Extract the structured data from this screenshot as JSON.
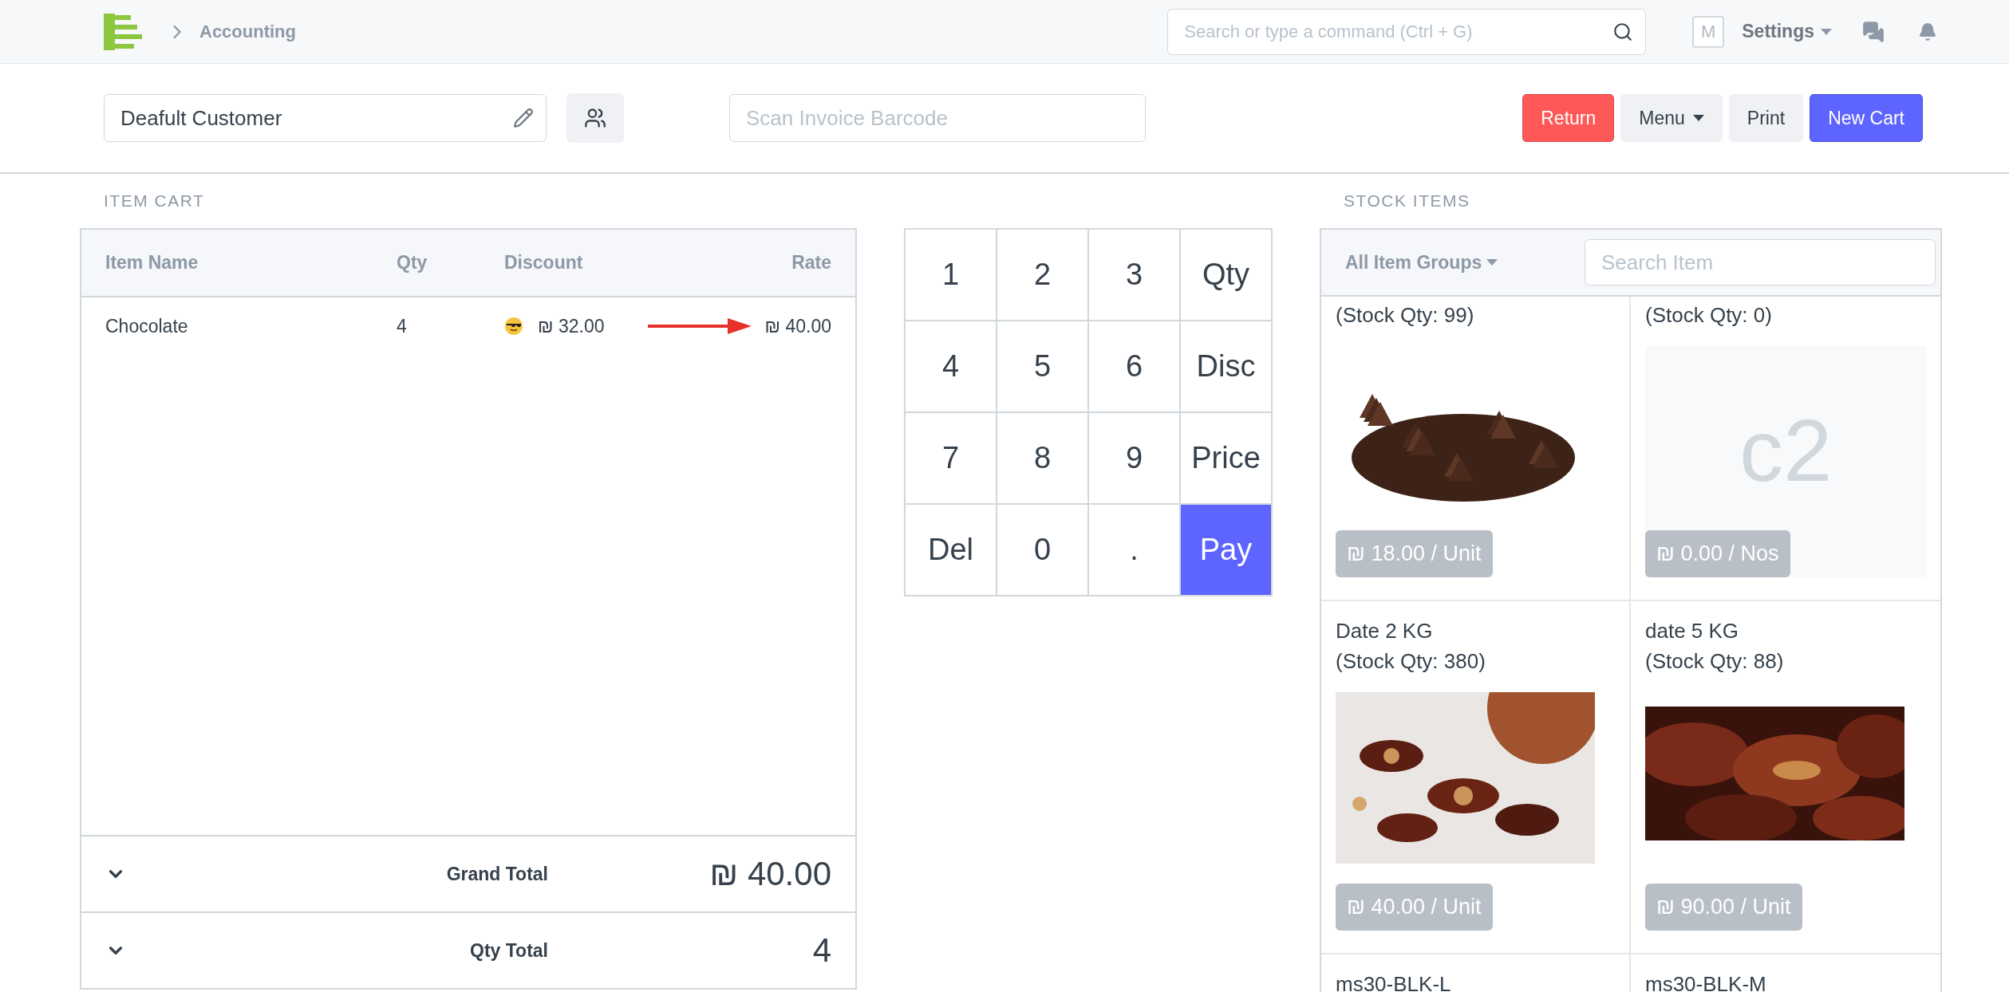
{
  "navbar": {
    "breadcrumb": "Accounting",
    "search": {
      "placeholder": "Search or type a command (Ctrl + G)"
    },
    "avatar": "M",
    "settings": "Settings"
  },
  "toolbar": {
    "customer": "Deafult Customer",
    "barcode": {
      "placeholder": "Scan Invoice Barcode"
    },
    "buttons": [
      {
        "label": "Return",
        "kind": "danger"
      },
      {
        "label": "Menu",
        "kind": "dropdown"
      },
      {
        "label": "Print",
        "kind": "default"
      },
      {
        "label": "New Cart",
        "kind": "primary"
      }
    ]
  },
  "cart": {
    "title": "ITEM CART",
    "columns": [
      "Item Name",
      "Qty",
      "Discount",
      "Rate"
    ],
    "rows": [
      {
        "item_name": "Chocolate",
        "qty": "4",
        "discount": "₪ 32.00",
        "rate": "₪ 40.00",
        "marked": true
      }
    ],
    "totals": [
      {
        "label": "Grand Total",
        "value": "₪ 40.00"
      },
      {
        "label": "Qty Total",
        "value": "4"
      }
    ]
  },
  "numpad": [
    {
      "label": "1",
      "selected": false
    },
    {
      "label": "2",
      "selected": false
    },
    {
      "label": "3",
      "selected": false
    },
    {
      "label": "Qty",
      "selected": false
    },
    {
      "label": "4",
      "selected": false
    },
    {
      "label": "5",
      "selected": false
    },
    {
      "label": "6",
      "selected": false
    },
    {
      "label": "Disc",
      "selected": false
    },
    {
      "label": "7",
      "selected": false
    },
    {
      "label": "8",
      "selected": false
    },
    {
      "label": "9",
      "selected": false
    },
    {
      "label": "Price",
      "selected": false
    },
    {
      "label": "Del",
      "selected": false
    },
    {
      "label": "0",
      "selected": false
    },
    {
      "label": ".",
      "selected": false
    },
    {
      "label": "Pay",
      "selected": true
    }
  ],
  "stock": {
    "title": "STOCK ITEMS",
    "group_filter": "All Item Groups",
    "search": {
      "placeholder": "Search Item"
    },
    "items": [
      {
        "stock_qty": "(Stock Qty: 99)",
        "price": "₪ 18.00 / Unit",
        "kind": "picture"
      },
      {
        "stock_qty": "(Stock Qty: 0)",
        "price": "₪ 0.00 / Nos",
        "kind": "placeholder",
        "placeholder": "c2"
      },
      {
        "name": "Date 2 KG",
        "stock_qty": "(Stock Qty: 380)",
        "price": "₪ 40.00 / Unit",
        "kind": "picture"
      },
      {
        "name": "date 5 KG",
        "stock_qty": "(Stock Qty: 88)",
        "price": "₪ 90.00 / Unit",
        "kind": "picture"
      },
      {
        "name": "ms30-BLK-L",
        "kind": "none"
      },
      {
        "name": "ms30-BLK-M",
        "kind": "none"
      }
    ]
  }
}
